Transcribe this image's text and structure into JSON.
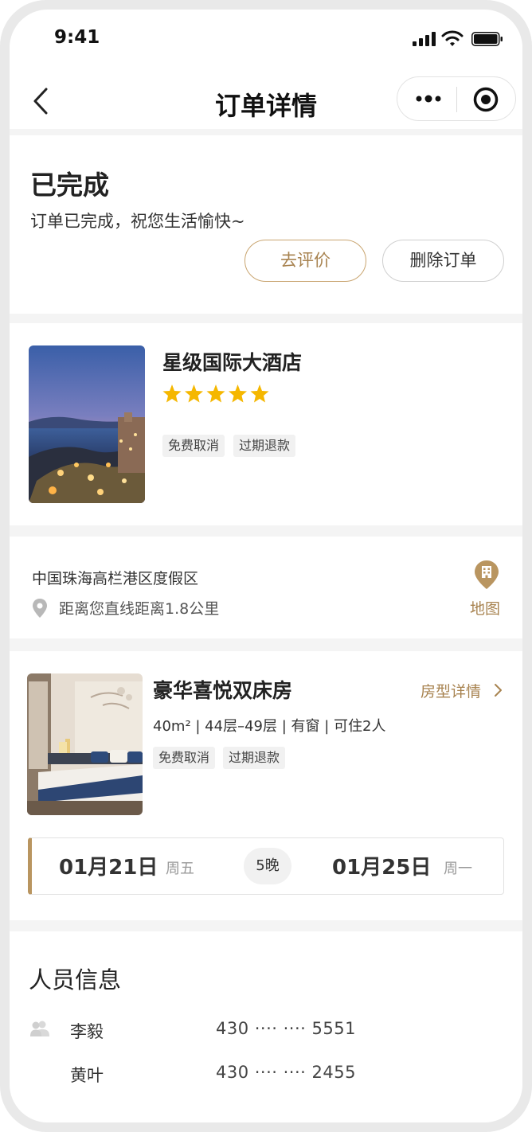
{
  "status_bar": {
    "time": "9:41"
  },
  "nav": {
    "title": "订单详情"
  },
  "order_status": {
    "title": "已完成",
    "subtitle": "订单已完成，祝您生活愉快~",
    "rate_button": "去评价",
    "delete_button": "删除订单"
  },
  "hotel": {
    "name": "星级国际大酒店",
    "star_rating": 5,
    "tags": [
      "免费取消",
      "过期退款"
    ]
  },
  "location": {
    "address": "中国珠海高栏港区度假区",
    "distance": "距离您直线距离1.8公里",
    "map_label": "地图"
  },
  "room": {
    "name": "豪华喜悦双床房",
    "detail_link": "房型详情",
    "info": "40m² | 44层–49层 | 有窗 | 可住2人",
    "tags": [
      "免费取消",
      "过期退款"
    ],
    "checkin_date": "01月21日",
    "checkin_weekday": "周五",
    "nights": "5晚",
    "checkout_date": "01月25日",
    "checkout_weekday": "周一"
  },
  "guests": {
    "title": "人员信息",
    "list": [
      {
        "name": "李毅",
        "id": "430 ···· ···· 5551"
      },
      {
        "name": "黄叶",
        "id": "430 ···· ···· 2455"
      }
    ]
  },
  "colors": {
    "accent": "#b99560",
    "accent_text": "#a88350",
    "star": "#f5b700"
  },
  "icons": [
    "back-arrow-icon",
    "more-dots-icon",
    "close-target-icon",
    "location-pin-icon",
    "map-building-icon",
    "chevron-right-icon",
    "person-icon",
    "signal-icon",
    "wifi-icon",
    "battery-icon"
  ]
}
